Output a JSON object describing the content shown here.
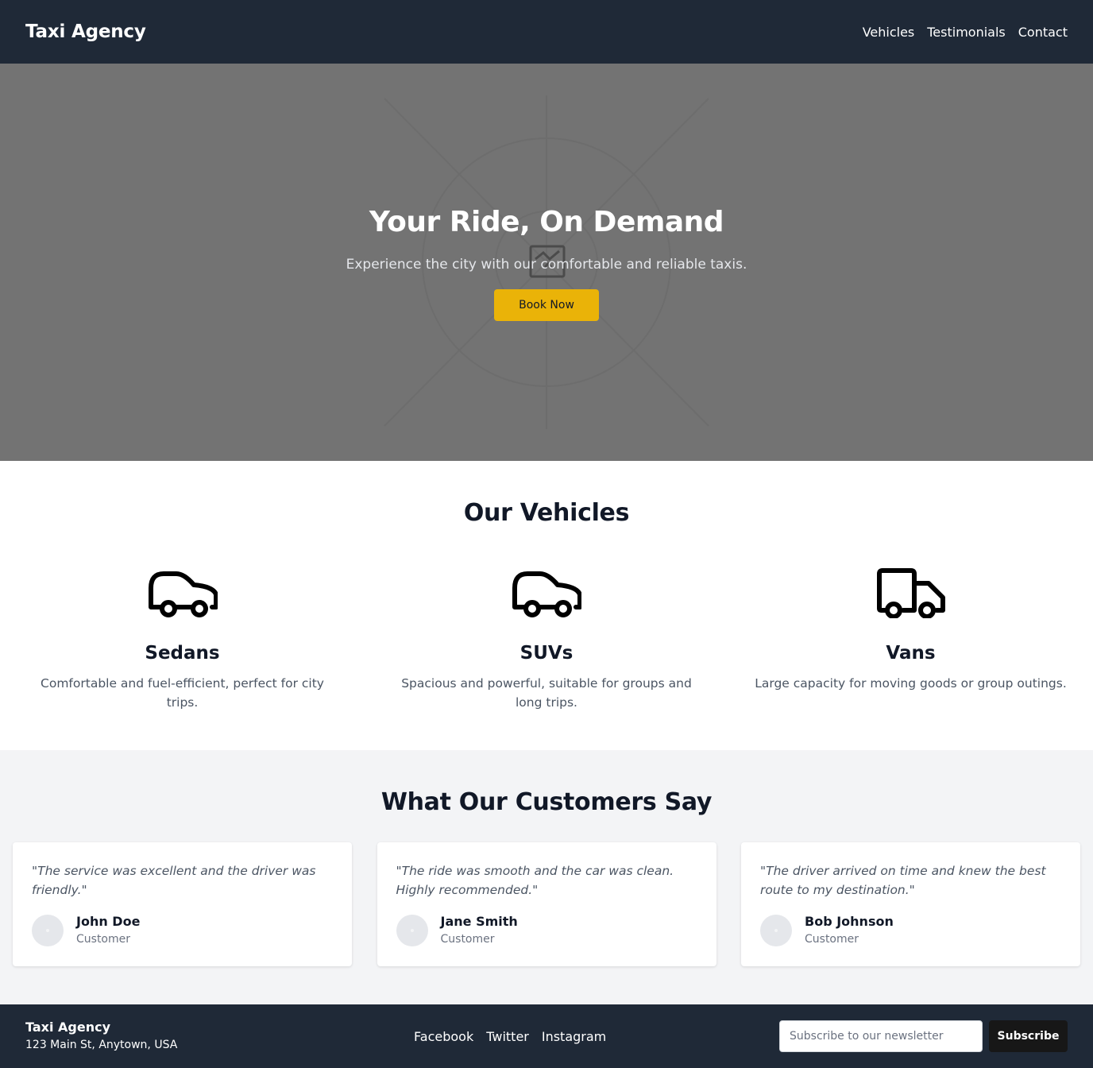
{
  "header": {
    "brand": "Taxi Agency",
    "nav": [
      {
        "label": "Vehicles"
      },
      {
        "label": "Testimonials"
      },
      {
        "label": "Contact"
      }
    ]
  },
  "hero": {
    "title": "Your Ride, On Demand",
    "subtitle": "Experience the city with our comfortable and reliable taxis.",
    "cta_label": "Book Now",
    "background_color": "#737373",
    "placeholder_icon": "broken-image-icon"
  },
  "vehicles": {
    "title": "Our Vehicles",
    "items": [
      {
        "name": "Sedans",
        "description": "Comfortable and fuel-efficient, perfect for city trips.",
        "icon": "car-icon"
      },
      {
        "name": "SUVs",
        "description": "Spacious and powerful, suitable for groups and long trips.",
        "icon": "car-icon"
      },
      {
        "name": "Vans",
        "description": "Large capacity for moving goods or group outings.",
        "icon": "truck-icon"
      }
    ]
  },
  "testimonials": {
    "title": "What Our Customers Say",
    "items": [
      {
        "quote": "\"The service was excellent and the driver was friendly.\"",
        "name": "John Doe",
        "role": "Customer"
      },
      {
        "quote": "\"The ride was smooth and the car was clean. Highly recommended.\"",
        "name": "Jane Smith",
        "role": "Customer"
      },
      {
        "quote": "\"The driver arrived on time and knew the best route to my destination.\"",
        "name": "Bob Johnson",
        "role": "Customer"
      }
    ]
  },
  "footer": {
    "brand": "Taxi Agency",
    "address": "123 Main St, Anytown, USA",
    "links": [
      {
        "label": "Facebook"
      },
      {
        "label": "Twitter"
      },
      {
        "label": "Instagram"
      }
    ],
    "newsletter_placeholder": "Subscribe to our newsletter",
    "newsletter_value": "",
    "subscribe_label": "Subscribe"
  },
  "colors": {
    "header_bg": "#1f2937",
    "accent": "#eab308",
    "section_alt_bg": "#f3f4f6"
  }
}
